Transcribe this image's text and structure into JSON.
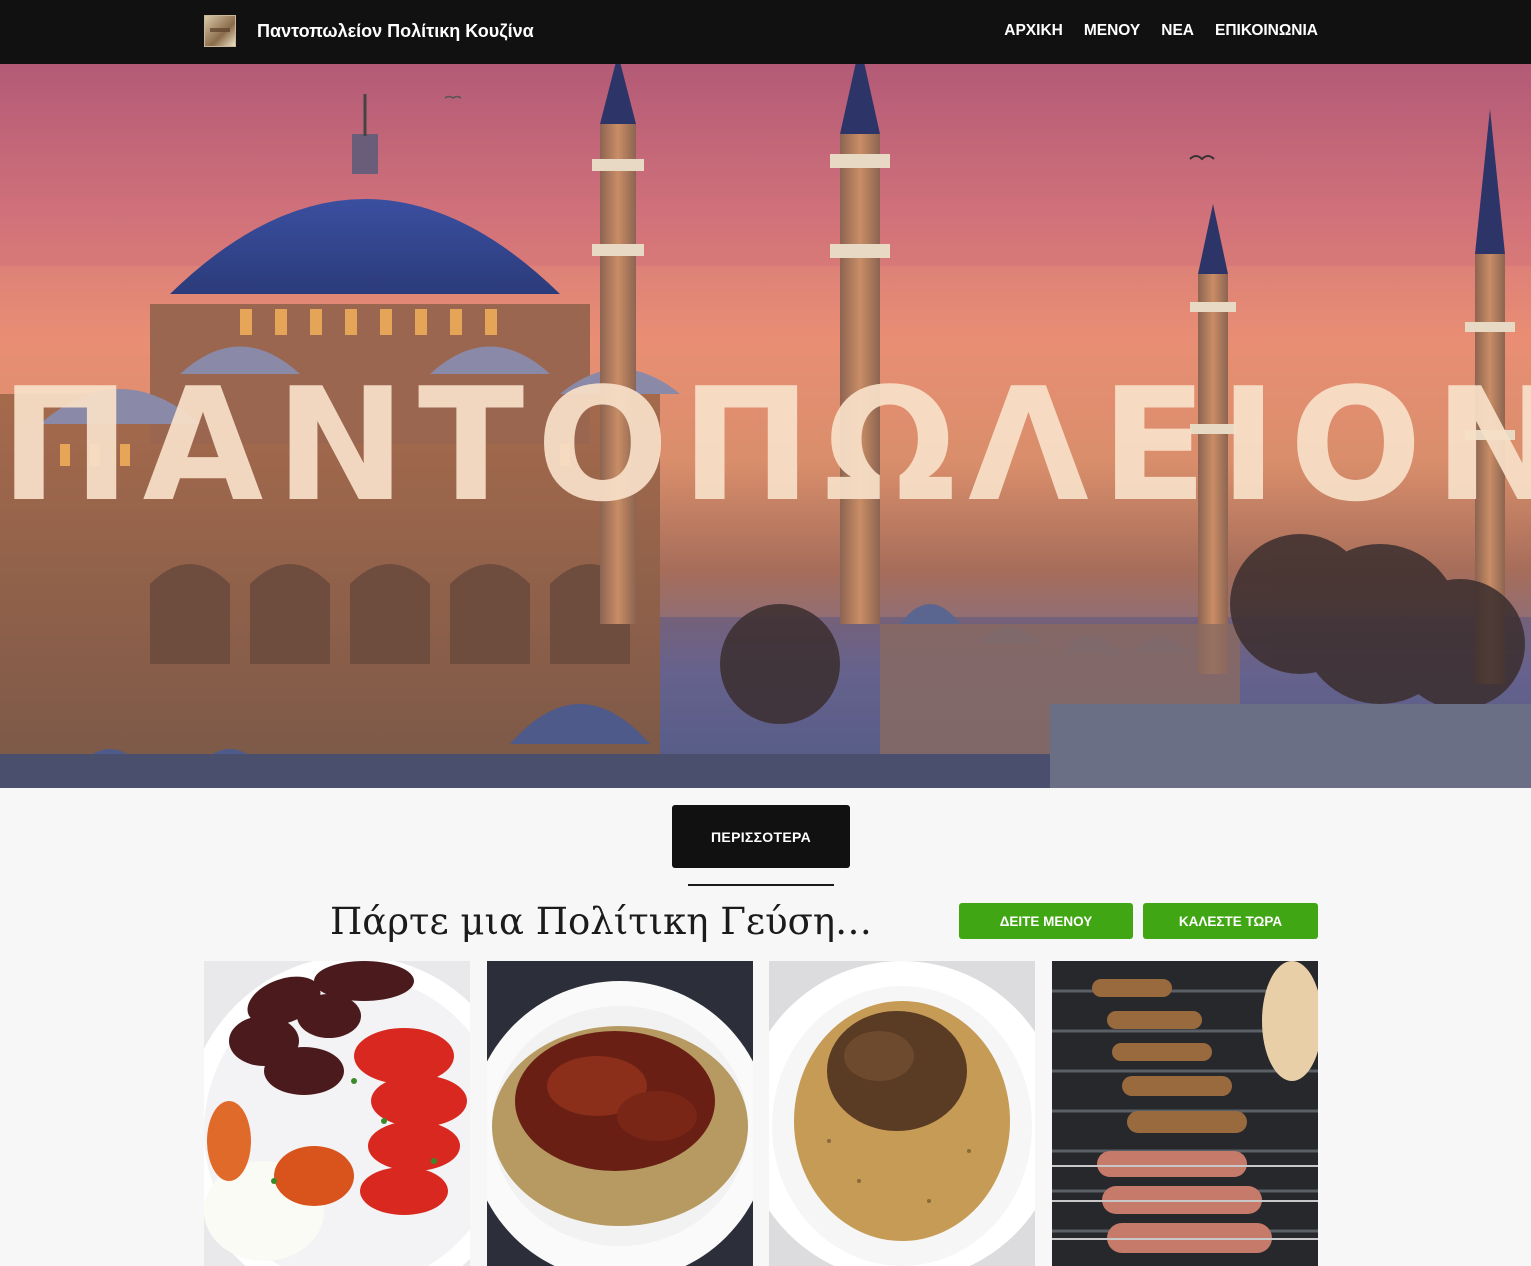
{
  "header": {
    "site_name": "Παντοπωλείον Πολίτικη Κουζίνα",
    "nav": [
      "ΑΡΧΙΚΗ",
      "ΜΕΝΟΥ",
      "ΝΕΑ",
      "ΕΠΙΚΟΙΝΩΝΙΑ"
    ]
  },
  "hero": {
    "word": "ΠΑΝΤΟΠΩΛΕΙΟΝ"
  },
  "main": {
    "more_label": "ΠΕΡΙΣΣΟΤΕΡΑ",
    "tagline": "Πάρτε μια Πολίτικη Γεύση…",
    "see_menu_label": "ΔΕΙΤΕ ΜΕΝΟΥ",
    "call_now_label": "ΚΑΛΕΣΤΕ ΤΩΡΑ"
  },
  "colors": {
    "topbar": "#111111",
    "accent_green": "#41a613",
    "page_bg": "#f7f7f7"
  }
}
